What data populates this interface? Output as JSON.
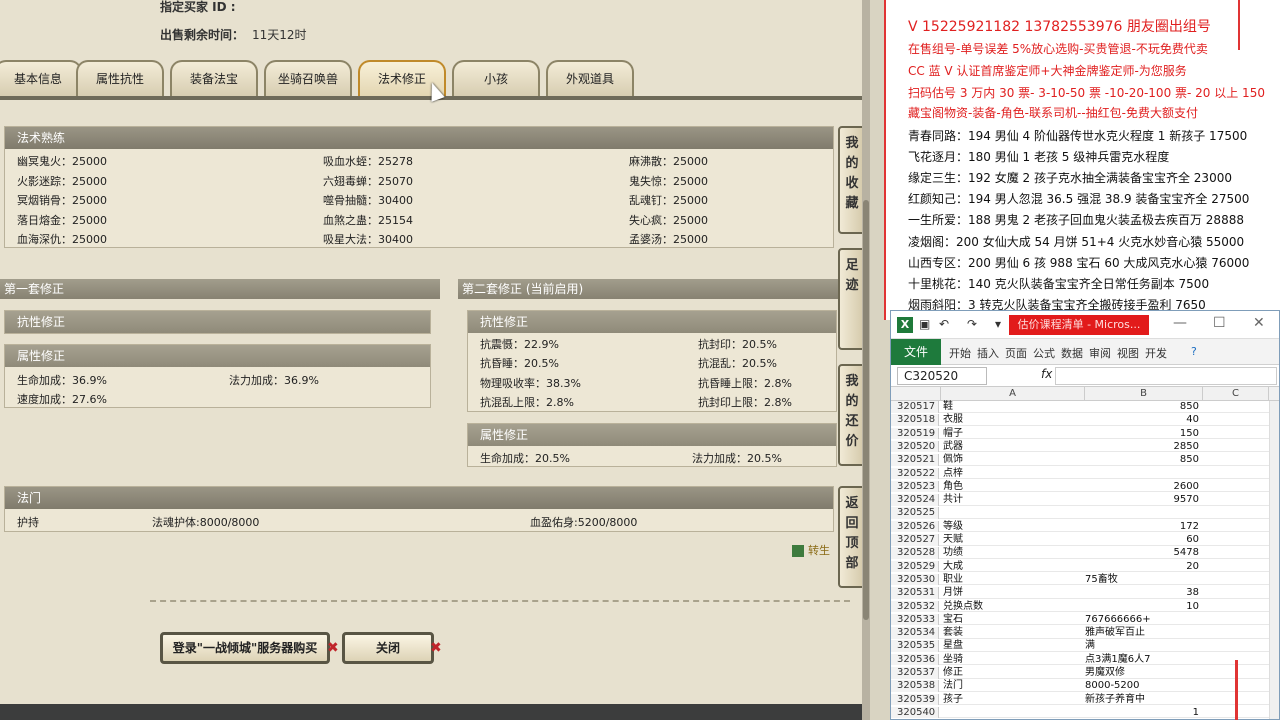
{
  "game": {
    "seller_label": "指定买家 ID :",
    "time_label": "出售剩余时间：",
    "time_value": "11天12时",
    "tabs": [
      "基本信息",
      "属性抗性",
      "装备法宝",
      "坐骑召唤兽",
      "法术修正",
      "小孩",
      "外观道具"
    ],
    "active_tab": "法术修正",
    "skills": {
      "title": "法术熟练",
      "col1": [
        "幽冥鬼火：25000",
        "火影迷踪：25000",
        "冥烟销骨：25000",
        "落日熔金：25000",
        "血海深仇：25000"
      ],
      "col2": [
        "吸血水蛭：25278",
        "六翅毒蝉：25070",
        "噬骨抽髓：30400",
        "血煞之蛊：25154",
        "吸星大法：30400"
      ],
      "col3": [
        "麻沸散：25000",
        "鬼失惊：25000",
        "乱魂钉：25000",
        "失心疯：25000",
        "孟婆汤：25000"
      ]
    },
    "suit1": {
      "title": "第一套修正",
      "resist_title": "抗性修正",
      "attr_title": "属性修正",
      "attr": [
        "生命加成：36.9%",
        "法力加成：36.9%",
        "速度加成：27.6%"
      ]
    },
    "suit2": {
      "title": "第二套修正 (当前启用)",
      "resist_title": "抗性修正",
      "resist": [
        "抗震慑：22.9%",
        "抗封印：20.5%",
        "抗昏睡：20.5%",
        "抗混乱：20.5%",
        "物理吸收率：38.3%",
        "抗昏睡上限：2.8%",
        "抗混乱上限：2.8%",
        "抗封印上限：2.8%"
      ],
      "attr_title": "属性修正",
      "attr": [
        "生命加成：20.5%",
        "法力加成：20.5%"
      ]
    },
    "fameng": {
      "title": "法门",
      "name": "护持",
      "item1": "法魂护体:8000/8000",
      "item2": "血盈佑身:5200/8000"
    },
    "side_buttons": [
      "我的收藏",
      "足迹",
      "我的还价",
      "返回顶部"
    ],
    "export_link": "转生",
    "btn_login": "登录\"一战倾城\"服务器购买",
    "btn_close": "关闭"
  },
  "doc": {
    "lines_red": [
      "V 15225921182   13782553976 朋友圈出组号",
      "在售组号-单号误差 5%放心选购-买贵管退-不玩免费代卖",
      "CC 蓝 V 认证首席鉴定师+大神金牌鉴定师-为您服务",
      "扫码估号 3 万内 30 票- 3-10-50 票   -10-20-100 票- 20 以上 150",
      "藏宝阁物资-装备-角色-联系司机--抽红包-免费大额支付"
    ],
    "lines_black": [
      "青春同路：194 男仙 4 阶仙器传世水克火程度 1 新孩子 17500",
      "飞花逐月：180 男仙 1 老孩 5 级神兵雷克水程度",
      "缘定三生：192 女魔 2 孩子克水抽全满装备宝宝齐全 23000",
      "红颜知己：194 男人忽混 36.5 强混 38.9 装备宝宝齐全 27500",
      "一生所爱：188 男鬼 2 老孩子回血鬼火装孟极去疾百万 28888",
      "凌烟阁：200 女仙大成 54 月饼 51+4 火克水妙音心猿 55000",
      "山西专区：200 男仙 6 孩 988 宝石 60 大成风克水心猿 76000",
      "十里桃花：140 克火队装备宝宝齐全日常任务副本 7500",
      "烟雨斜阳：3 转克火队装备宝宝齐全搬砖接手盈利 7650"
    ]
  },
  "excel": {
    "title": "估价课程清单 - Micros...",
    "file_tab": "文件",
    "ribbon_tabs": [
      "开始",
      "插入",
      "页面",
      "公式",
      "数据",
      "审阅",
      "视图",
      "开发"
    ],
    "name_box": "C320520",
    "fx": "fx",
    "col_a": "A",
    "col_b": "B",
    "col_c": "C",
    "rows": [
      {
        "n": "320517",
        "a": "鞋",
        "b": "850",
        "num": true
      },
      {
        "n": "320518",
        "a": "衣服",
        "b": "40",
        "num": true
      },
      {
        "n": "320519",
        "a": "帽子",
        "b": "150",
        "num": true
      },
      {
        "n": "320520",
        "a": "武器",
        "b": "2850",
        "num": true
      },
      {
        "n": "320521",
        "a": "佩饰",
        "b": "850",
        "num": true
      },
      {
        "n": "320522",
        "a": "点梓",
        "b": "",
        "num": true
      },
      {
        "n": "320523",
        "a": "角色",
        "b": "2600",
        "num": true
      },
      {
        "n": "320524",
        "a": "共计",
        "b": "9570",
        "num": true
      },
      {
        "n": "320525",
        "a": "",
        "b": "",
        "num": true
      },
      {
        "n": "320526",
        "a": "等级",
        "b": "172",
        "num": true
      },
      {
        "n": "320527",
        "a": "天赋",
        "b": "60",
        "num": true
      },
      {
        "n": "320528",
        "a": "功绩",
        "b": "5478",
        "num": true
      },
      {
        "n": "320529",
        "a": "大成",
        "b": "20",
        "num": true
      },
      {
        "n": "320530",
        "a": "职业",
        "b": "75畜牧",
        "num": false
      },
      {
        "n": "320531",
        "a": "月饼",
        "b": "38",
        "num": true
      },
      {
        "n": "320532",
        "a": "兑换点数",
        "b": "10",
        "num": true
      },
      {
        "n": "320533",
        "a": "宝石",
        "b": "767666666+",
        "num": false
      },
      {
        "n": "320534",
        "a": "套装",
        "b": "雅声破军百止",
        "num": false
      },
      {
        "n": "320535",
        "a": "星盘",
        "b": "满",
        "num": false
      },
      {
        "n": "320536",
        "a": "坐骑",
        "b": "点3满1魔6人7",
        "num": false
      },
      {
        "n": "320537",
        "a": "修正",
        "b": "男魔双修",
        "num": false
      },
      {
        "n": "320538",
        "a": "法门",
        "b": "8000-5200",
        "num": false
      },
      {
        "n": "320539",
        "a": "孩子",
        "b": "新孩子养育中",
        "num": false
      },
      {
        "n": "320540",
        "a": "",
        "b": "1",
        "num": true
      }
    ]
  }
}
